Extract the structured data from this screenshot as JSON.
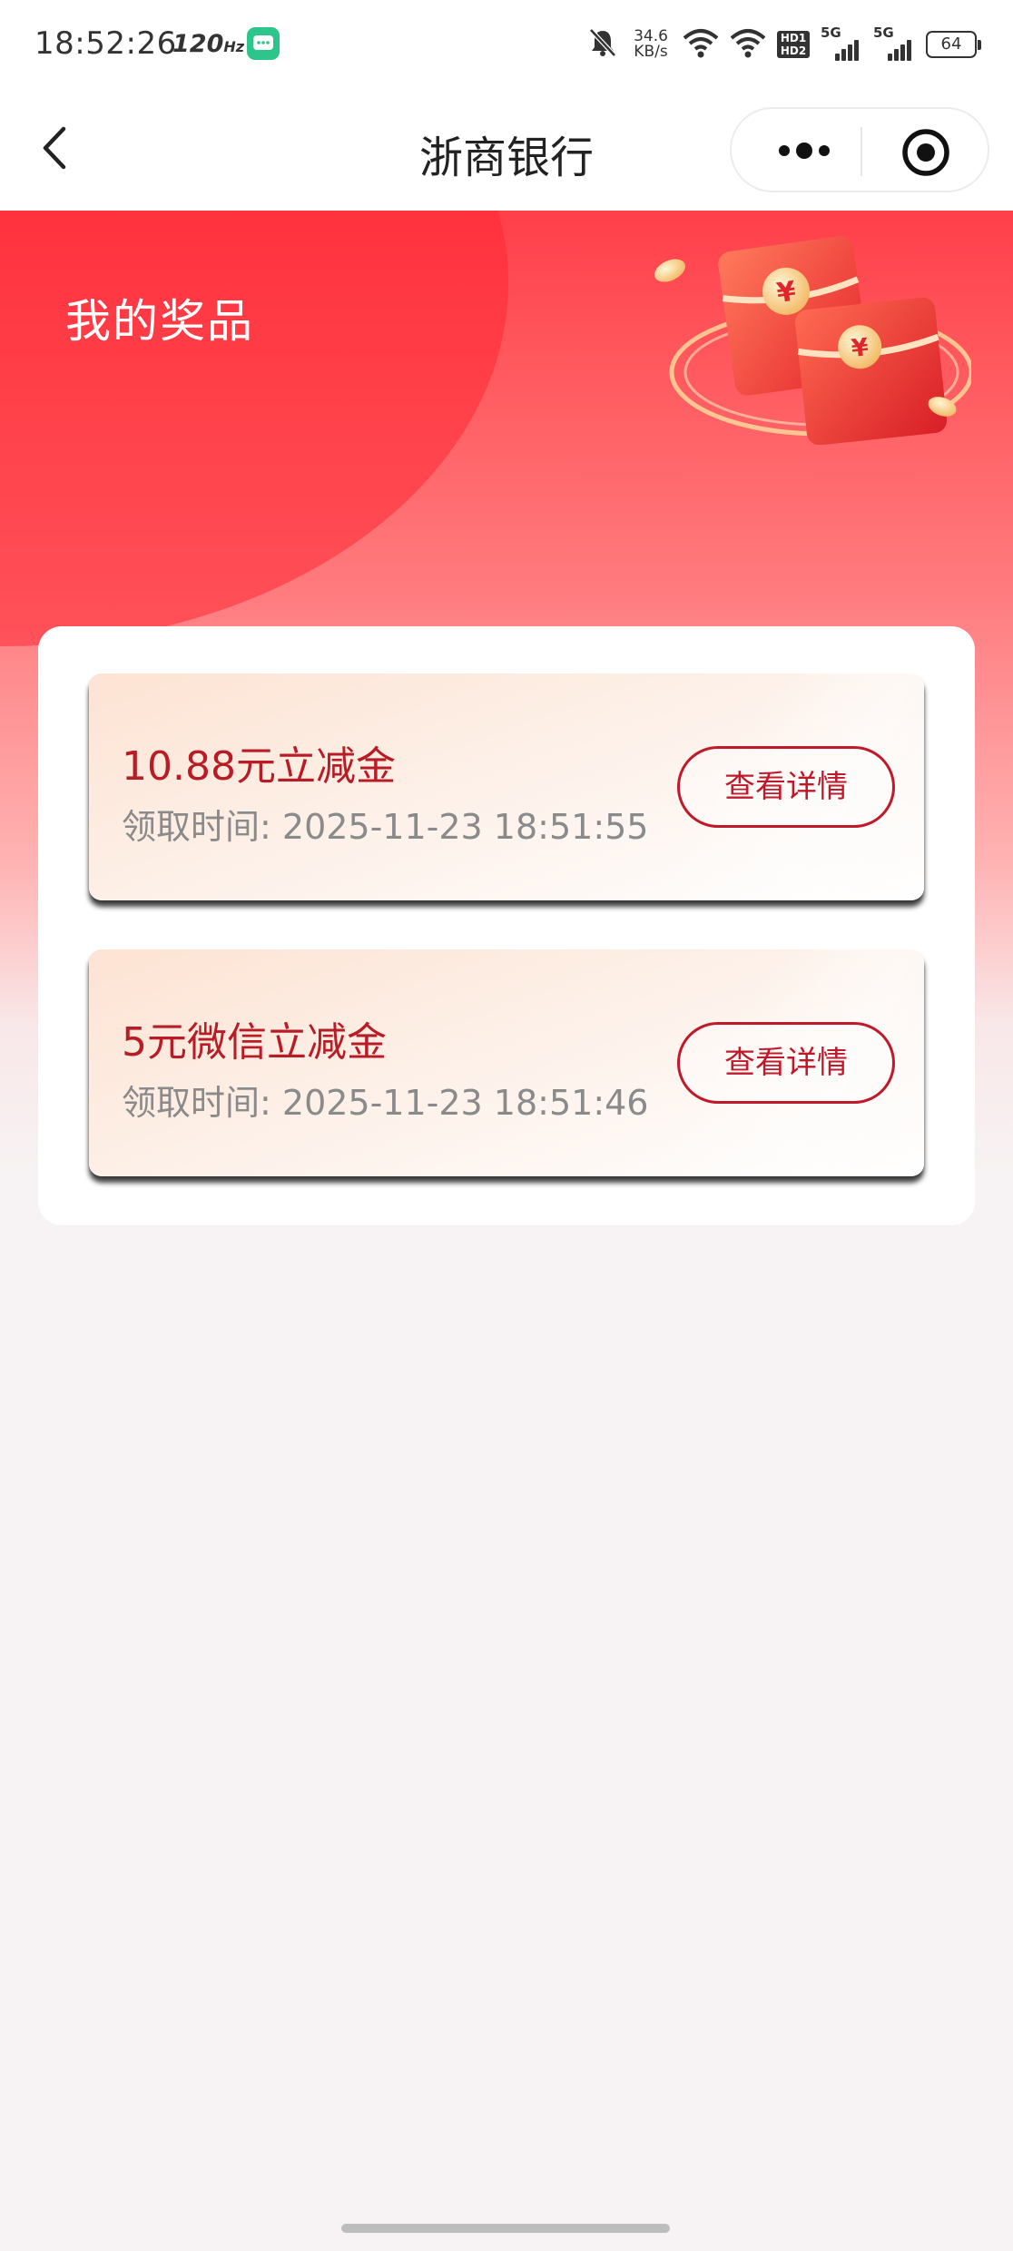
{
  "status_bar": {
    "time": "18:52:26",
    "refresh_rate": "120",
    "refresh_unit": "Hz",
    "net_speed_value": "34.6",
    "net_speed_unit": "KB/s",
    "hd_label_1": "HD1",
    "hd_label_2": "HD2",
    "sim1_label": "5G",
    "sim2_label": "5G",
    "battery_level": "64",
    "icons": [
      "message-app-icon",
      "bell-muted-icon",
      "wifi-icon",
      "wifi-icon",
      "signal-icon",
      "signal-icon",
      "battery-icon"
    ]
  },
  "nav": {
    "title": "浙商银行",
    "back_icon": "back-chevron-icon",
    "more_icon": "more-dots-icon",
    "close_icon": "target-close-icon"
  },
  "page": {
    "title": "我的奖品",
    "illustration": "red-envelope-illustration"
  },
  "prizes": [
    {
      "name": "10.88元立减金",
      "time_label": "领取时间: ",
      "time_value": "2025-11-23 18:51:55",
      "button_label": "查看详情"
    },
    {
      "name": "5元微信立减金",
      "time_label": "领取时间: ",
      "time_value": "2025-11-23 18:51:46",
      "button_label": "查看详情"
    }
  ],
  "colors": {
    "brand_red": "#ff3f4a",
    "prize_text": "#b81c25",
    "button_border": "#c0192a",
    "background": "#f7f2f3"
  }
}
